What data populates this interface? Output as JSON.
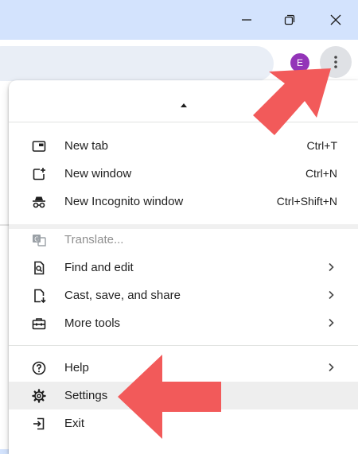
{
  "profile": {
    "initial": "E",
    "color": "#9334b8"
  },
  "accent": {
    "arrow_color": "#f25a5a",
    "titlebar": "#d3e3fd",
    "highlight": "#eeeeee"
  },
  "window_controls": {
    "minimize_icon": "minimize-icon",
    "restore_icon": "restore-icon",
    "close_icon": "close-icon"
  },
  "menu": {
    "groups": [
      {
        "items": [
          {
            "label": "New tab",
            "shortcut": "Ctrl+T",
            "icon": "new-tab-icon"
          },
          {
            "label": "New window",
            "shortcut": "Ctrl+N",
            "icon": "new-window-icon"
          },
          {
            "label": "New Incognito window",
            "shortcut": "Ctrl+Shift+N",
            "icon": "incognito-icon"
          }
        ]
      },
      {
        "items": [
          {
            "label": "Translate...",
            "icon": "translate-icon",
            "disabled": true
          },
          {
            "label": "Find and edit",
            "icon": "find-icon",
            "submenu": true
          },
          {
            "label": "Cast, save, and share",
            "icon": "cast-save-share-icon",
            "submenu": true
          },
          {
            "label": "More tools",
            "icon": "toolbox-icon",
            "submenu": true
          }
        ]
      },
      {
        "items": [
          {
            "label": "Help",
            "icon": "help-icon",
            "submenu": true
          },
          {
            "label": "Settings",
            "icon": "settings-icon",
            "highlighted": true
          },
          {
            "label": "Exit",
            "icon": "exit-icon"
          }
        ]
      }
    ]
  }
}
